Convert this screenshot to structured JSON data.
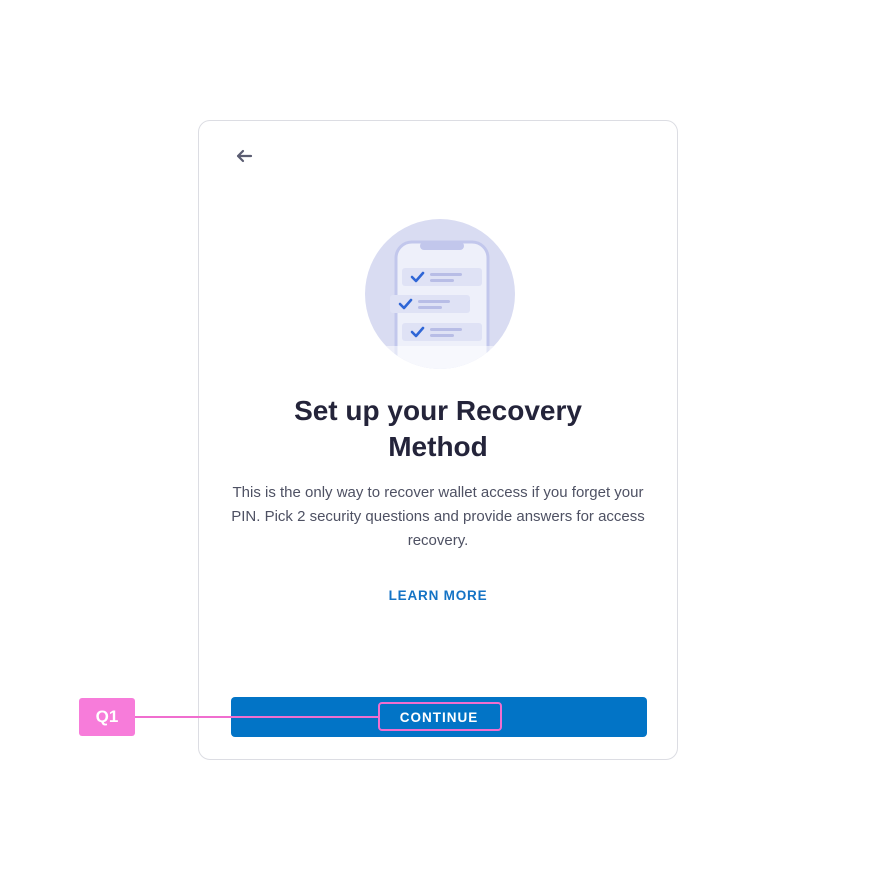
{
  "title": "Set up your Recovery Method",
  "description": "This is the only way to recover wallet access if you forget your PIN. Pick 2 security questions and provide answers for access recovery.",
  "learn_more_label": "LEARN MORE",
  "continue_label": "CONTINUE",
  "annotation": {
    "tag_label": "Q1"
  },
  "icons": {
    "back": "arrow-left-icon",
    "illustration": "phone-checklist-illustration"
  },
  "colors": {
    "primary": "#0274c6",
    "link": "#1473c5",
    "title": "#24243a",
    "body": "#4e5163",
    "annotation": "#f77cda"
  }
}
